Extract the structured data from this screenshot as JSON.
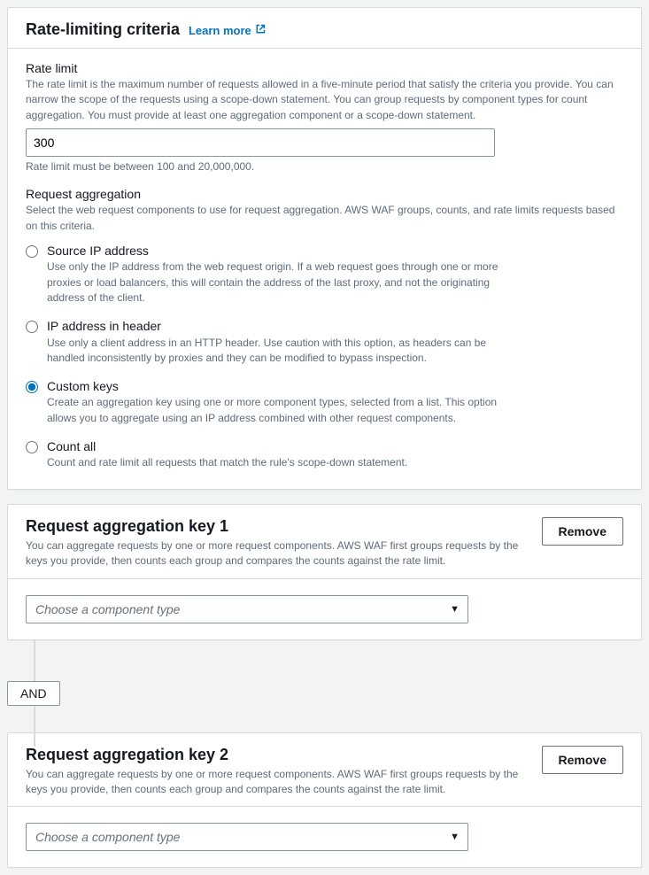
{
  "criteria": {
    "title": "Rate-limiting criteria",
    "learn_more": "Learn more",
    "rate_limit": {
      "label": "Rate limit",
      "description": "The rate limit is the maximum number of requests allowed in a five-minute period that satisfy the criteria you provide. You can narrow the scope of the requests using a scope-down statement. You can group requests by component types for count aggregation. You must provide at least one aggregation component or a scope-down statement.",
      "value": "300",
      "constraint": "Rate limit must be between 100 and 20,000,000."
    },
    "aggregation": {
      "label": "Request aggregation",
      "description": "Select the web request components to use for request aggregation. AWS WAF groups, counts, and rate limits requests based on this criteria.",
      "selected": "custom",
      "options": {
        "source_ip": {
          "title": "Source IP address",
          "description": "Use only the IP address from the web request origin. If a web request goes through one or more proxies or load balancers, this will contain the address of the last proxy, and not the originating address of the client."
        },
        "header_ip": {
          "title": "IP address in header",
          "description": "Use only a client address in an HTTP header. Use caution with this option, as headers can be handled inconsistently by proxies and they can be modified to bypass inspection."
        },
        "custom": {
          "title": "Custom keys",
          "description": "Create an aggregation key using one or more component types, selected from a list. This option allows you to aggregate using an IP address combined with other request components."
        },
        "count_all": {
          "title": "Count all",
          "description": "Count and rate limit all requests that match the rule's scope-down statement."
        }
      }
    }
  },
  "connector": {
    "label": "AND"
  },
  "keys": [
    {
      "title": "Request aggregation key 1",
      "description": "You can aggregate requests by one or more request components. AWS WAF first groups requests by the keys you provide, then counts each group and compares the counts against the rate limit.",
      "remove_label": "Remove",
      "select_placeholder": "Choose a component type"
    },
    {
      "title": "Request aggregation key 2",
      "description": "You can aggregate requests by one or more request components. AWS WAF first groups requests by the keys you provide, then counts each group and compares the counts against the rate limit.",
      "remove_label": "Remove",
      "select_placeholder": "Choose a component type"
    }
  ]
}
